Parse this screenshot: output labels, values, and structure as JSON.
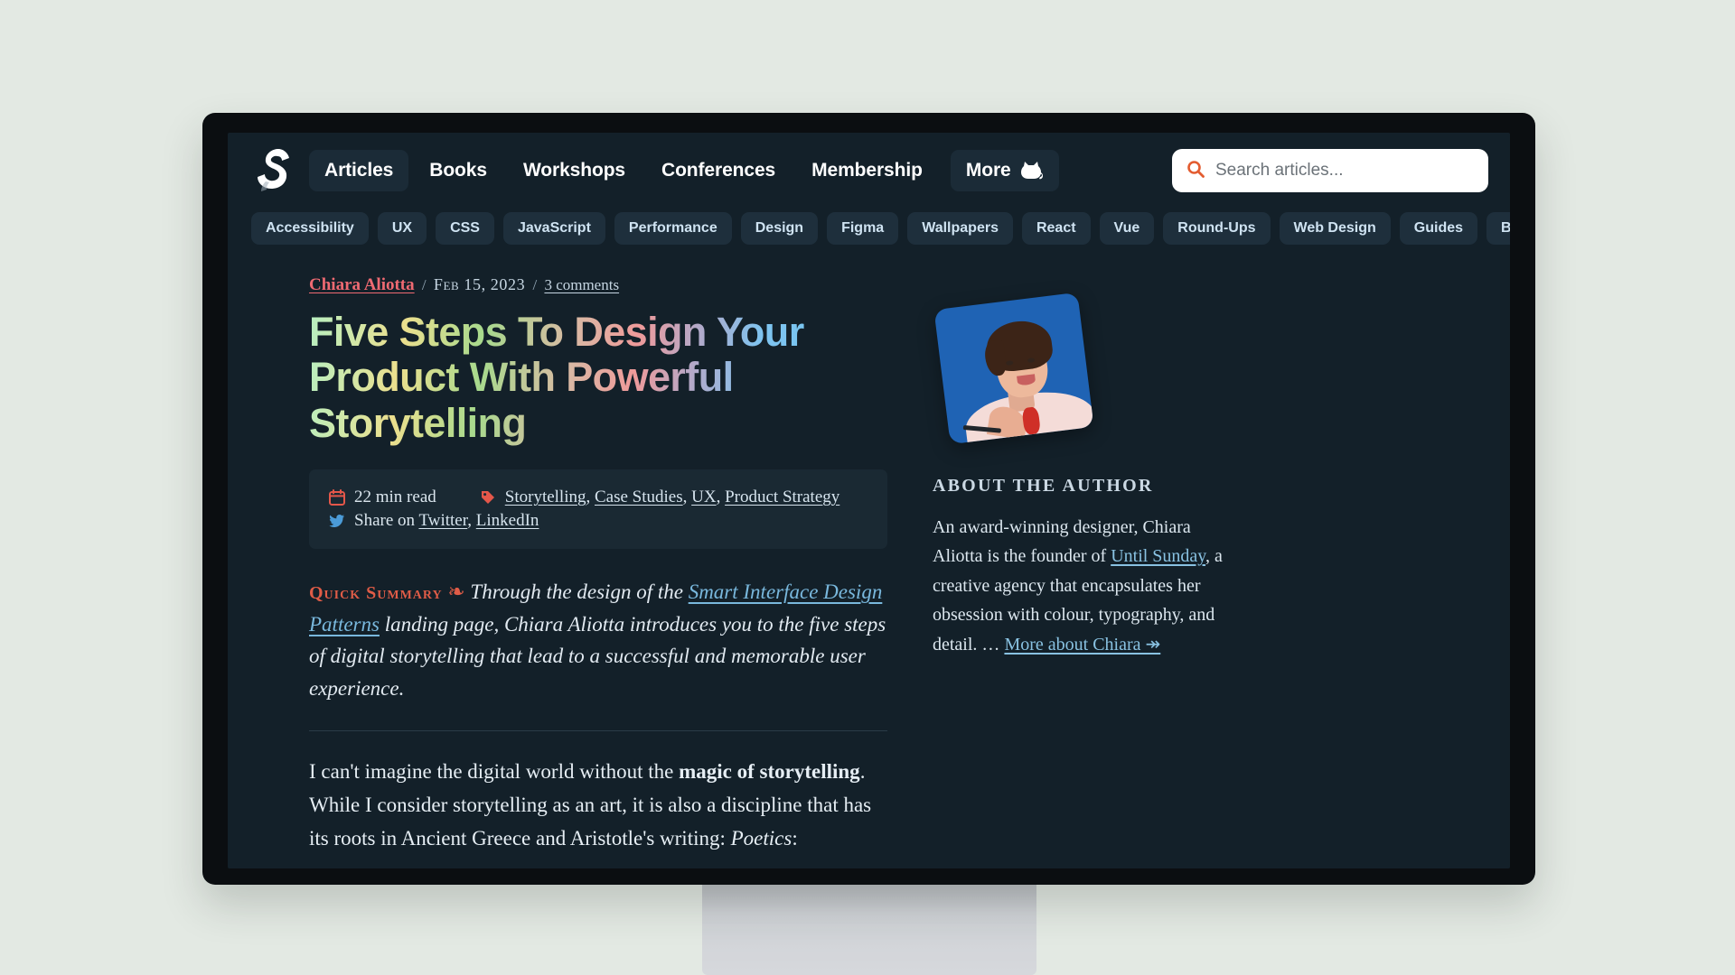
{
  "site": {
    "logo_name": "smashing-magazine-logo"
  },
  "nav": {
    "items": [
      {
        "label": "Articles",
        "active": true
      },
      {
        "label": "Books",
        "active": false
      },
      {
        "label": "Workshops",
        "active": false
      },
      {
        "label": "Conferences",
        "active": false
      },
      {
        "label": "Membership",
        "active": false
      }
    ],
    "more_label": "More",
    "more_icon": "cat-icon"
  },
  "search": {
    "placeholder": "Search articles...",
    "value": "",
    "icon": "search-icon",
    "icon_color": "#e35c30"
  },
  "categories": [
    "Accessibility",
    "UX",
    "CSS",
    "JavaScript",
    "Performance",
    "Design",
    "Figma",
    "Wallpapers",
    "React",
    "Vue",
    "Round-Ups",
    "Web Design",
    "Guides",
    "Business"
  ],
  "article": {
    "byline": {
      "author": "Chiara Aliotta",
      "separator": "/",
      "date": "Feb 15, 2023",
      "comments": "3 comments"
    },
    "title": "Five Steps To Design Your Product With Powerful Storytelling",
    "meta": {
      "read_time": "22 min read",
      "read_time_icon": "calendar-icon",
      "tags_icon": "tag-icon",
      "tags": [
        "Storytelling",
        "Case Studies",
        "UX",
        "Product Strategy"
      ],
      "share_icon": "twitter-icon",
      "share_prefix": "Share on",
      "share_links": [
        "Twitter",
        "LinkedIn"
      ]
    },
    "quick_summary": {
      "label": "Quick Summary",
      "glyph": "❧",
      "text_before": "Through the design of the",
      "link": "Smart Interface Design Patterns",
      "text_after": "landing page, Chiara Aliotta introduces you to the five steps of digital storytelling that lead to a successful and memorable user experience."
    },
    "body": {
      "p1_a": "I can't imagine the digital world without the ",
      "p1_bold": "magic of storytelling",
      "p1_b": ". While I consider storytelling as an art, it is also a discipline that has its roots in Ancient Greece and Aristotle's writing: ",
      "p1_italic": "Poetics",
      "p1_c": ":"
    }
  },
  "aside": {
    "photo_name": "author-portrait",
    "heading": "About The Author",
    "bio_a": "An award-winning designer, Chiara Aliotta is the founder of ",
    "bio_link": "Until Sunday",
    "bio_b": ", a creative agency that encapsulates her obsession with colour, typography, and detail. … ",
    "more_link": "More about Chiara ↠"
  },
  "colors": {
    "page_background": "#132029",
    "accent_red": "#e05c47",
    "link_blue": "#79b8dd",
    "author_red": "#ef6a72",
    "pill_background": "#1e2f3c",
    "desktop_background": "#e3e9e3"
  }
}
